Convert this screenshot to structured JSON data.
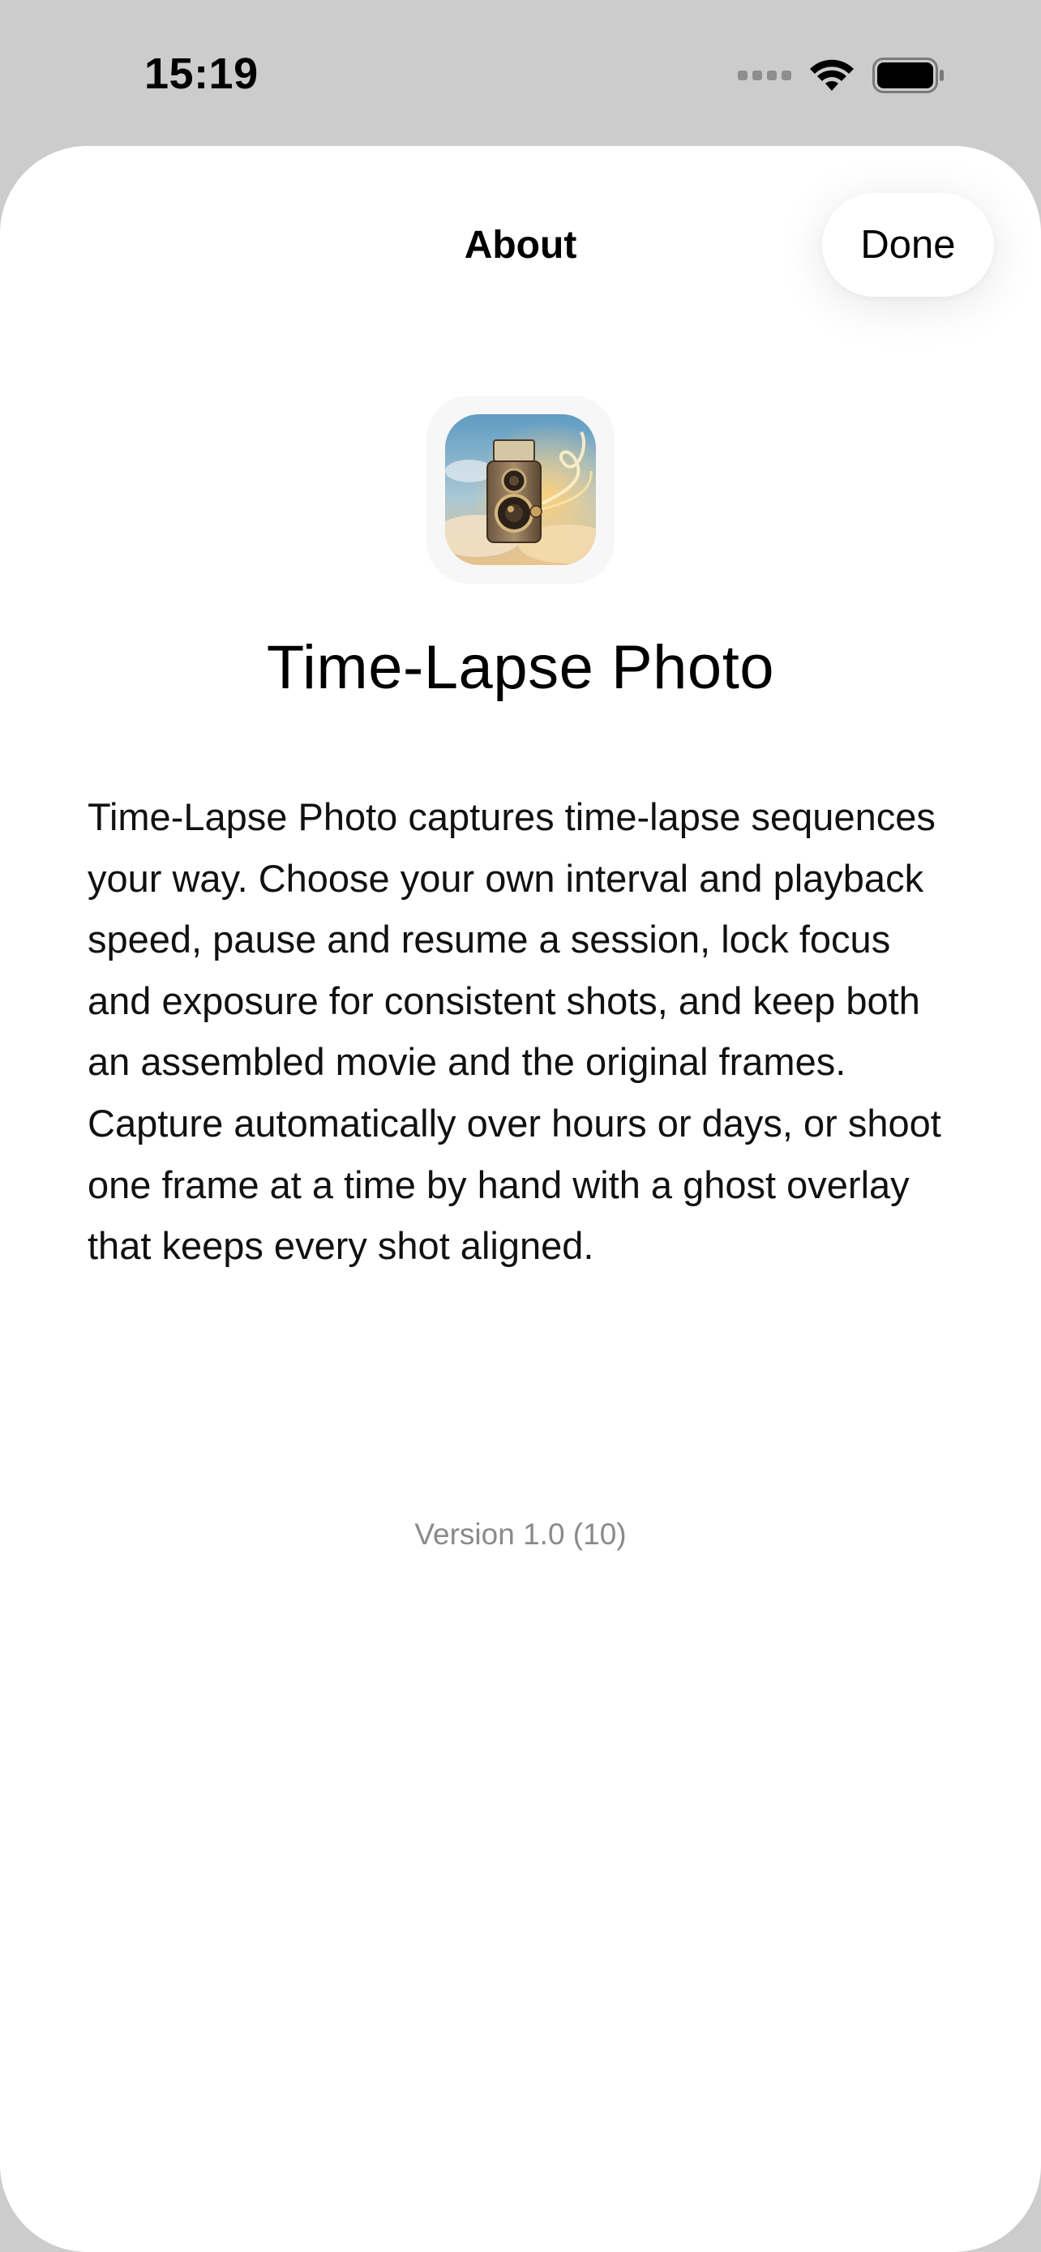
{
  "status_bar": {
    "time": "15:19",
    "icons": [
      "cellular-signal-icon",
      "wifi-icon",
      "battery-icon"
    ]
  },
  "sheet": {
    "title": "About",
    "done_label": "Done",
    "app_icon": "camera-app-icon",
    "app_name": "Time-Lapse Photo",
    "description": "Time-Lapse Photo captures time-lapse sequences your way. Choose your own interval and playback speed, pause and resume a session, lock focus and exposure for consistent shots, and keep both an assembled movie and the original frames. Capture automatically over hours or days, or shoot one frame at a time by hand with a ghost overlay that keeps every shot aligned.",
    "version": "Version 1.0 (10)"
  },
  "colors": {
    "backdrop": "#cccccc",
    "sheet_background": "#ffffff",
    "secondary_text": "#8a8a8e"
  }
}
